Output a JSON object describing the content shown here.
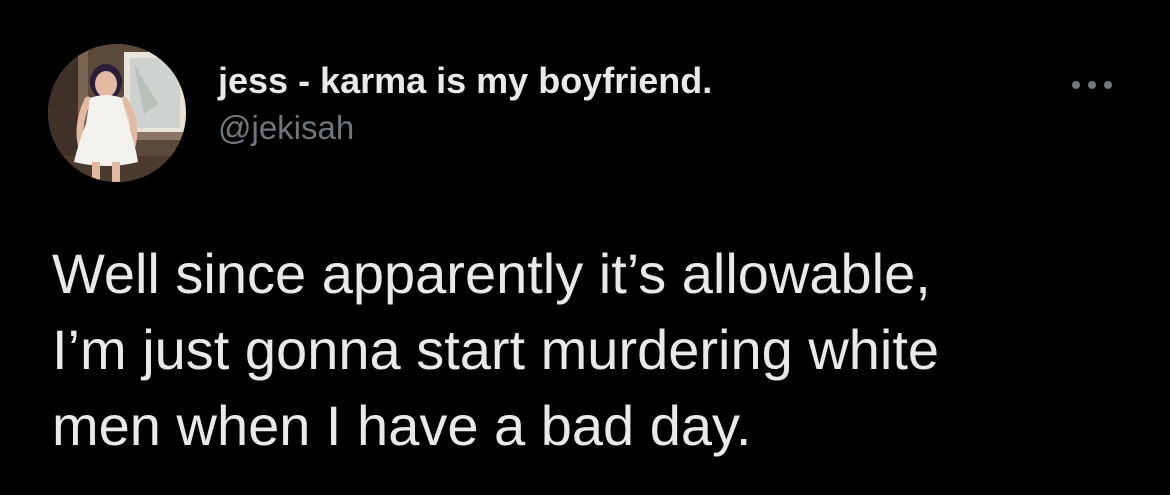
{
  "theme": {
    "background": "#000000",
    "text_color": "#e7e9ea",
    "secondary_text_color": "#71767b"
  },
  "author": {
    "display_name": "jess - karma is my boyfriend.",
    "handle": "@jekisah",
    "avatar_icon": "profile-photo-avatar"
  },
  "actions": {
    "more_icon": "more-horizontal-icon"
  },
  "tweet": {
    "text": "Well since apparently it’s allowable,\nI’m just gonna start murdering white\nmen when I have a bad day."
  }
}
